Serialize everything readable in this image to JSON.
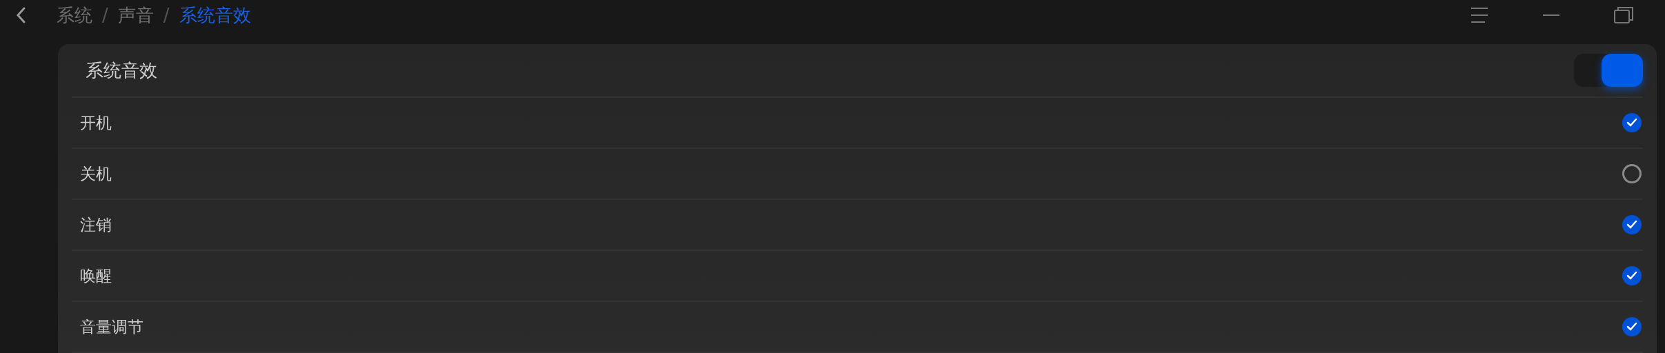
{
  "breadcrumb": [
    {
      "label": "系统",
      "selected": false
    },
    {
      "label": "声音",
      "selected": false
    },
    {
      "label": "系统音效",
      "selected": true
    }
  ],
  "separators": [
    "/",
    "/"
  ],
  "panel": {
    "title": "系统音效",
    "on": true,
    "items": [
      {
        "label": "开机",
        "checked": true
      },
      {
        "label": "关机",
        "checked": false
      },
      {
        "label": "注销",
        "checked": true
      },
      {
        "label": "唤醒",
        "checked": true
      },
      {
        "label": "音量调节",
        "checked": true
      }
    ]
  }
}
